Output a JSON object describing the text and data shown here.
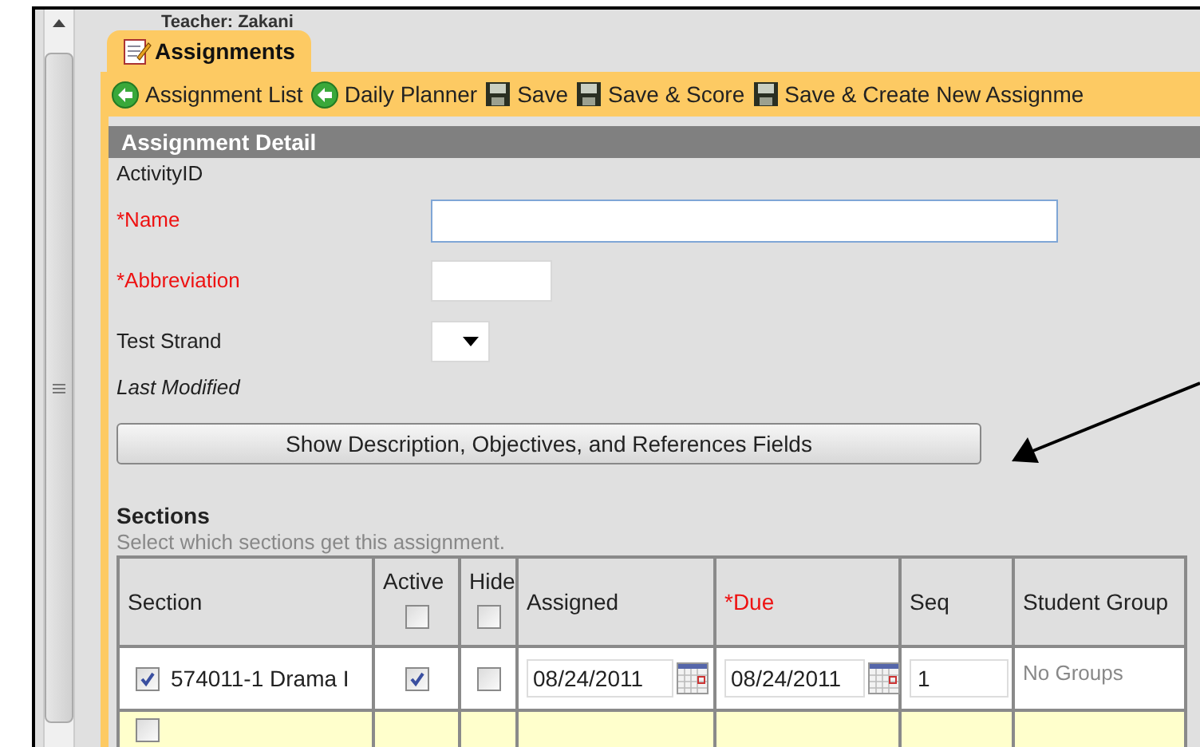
{
  "teacher": "Teacher: Zakani",
  "tab": {
    "label": "Assignments",
    "selected": true
  },
  "toolbar": [
    {
      "label": "Assignment List",
      "kind": "back"
    },
    {
      "label": "Daily Planner",
      "kind": "back"
    },
    {
      "label": "Save",
      "kind": "save"
    },
    {
      "label": "Save & Score",
      "kind": "save"
    },
    {
      "label": "Save & Create New Assignme",
      "kind": "save"
    }
  ],
  "panel_title": "Assignment Detail",
  "fields": [
    {
      "label": "ActivityID",
      "kind": "none",
      "required": false
    },
    {
      "label": "*Name",
      "kind": "wide",
      "required": true,
      "focused": true
    },
    {
      "label": "*Abbreviation",
      "kind": "short",
      "required": true
    },
    {
      "label": "Test Strand",
      "kind": "select",
      "required": false
    },
    {
      "label": "Last Modified",
      "kind": "note",
      "required": false
    }
  ],
  "toggle_button": "Show Description, Objectives, and References Fields",
  "sections": {
    "title": "Sections",
    "hint": "Select which sections get this assignment.",
    "columns": [
      {
        "label": "Section",
        "required": false
      },
      {
        "label": "Active",
        "required": false,
        "checked": false
      },
      {
        "label": "Hide",
        "required": false,
        "checked": false
      },
      {
        "label": "Assigned",
        "required": false
      },
      {
        "label": "*Due",
        "required": true
      },
      {
        "label": "Seq",
        "required": false
      },
      {
        "label": "Student Group",
        "required": false
      }
    ],
    "rows": [
      {
        "checked": true,
        "section": "574011-1 Drama I",
        "active": true,
        "hide": false,
        "assigned": "08/24/2011",
        "due": "08/24/2011",
        "seq": "1",
        "student_group": "No Groups"
      },
      {
        "checked": false
      }
    ]
  }
}
